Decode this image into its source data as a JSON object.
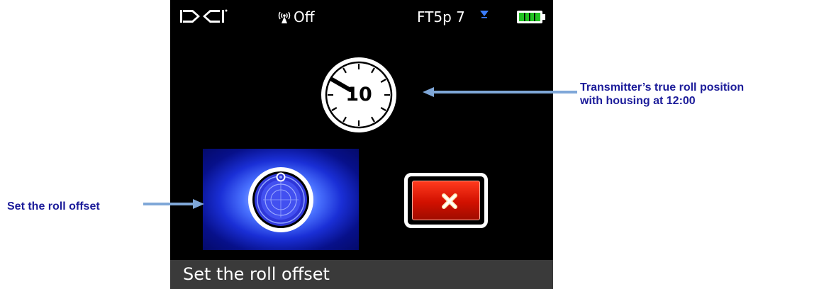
{
  "status_bar": {
    "signal_label": "Off",
    "channel_label": "FT5p 7"
  },
  "roll": {
    "value": "10"
  },
  "buttons": {
    "set_roll_offset": "roll-offset-icon",
    "cancel": "close-icon"
  },
  "footer": {
    "label": "Set the roll offset"
  },
  "annotations": {
    "true_roll_line1": "Transmitter’s true roll position",
    "true_roll_line2": "with housing at 12:00",
    "set_roll": "Set the roll offset"
  },
  "colors": {
    "annotation_text": "#1c1c9a",
    "annotation_arrow": "#7fa7d8",
    "screen_bg": "#000000",
    "cancel_red": "#d11000",
    "button_blue": "#1a2fd6",
    "battery_green": "#22c322"
  }
}
